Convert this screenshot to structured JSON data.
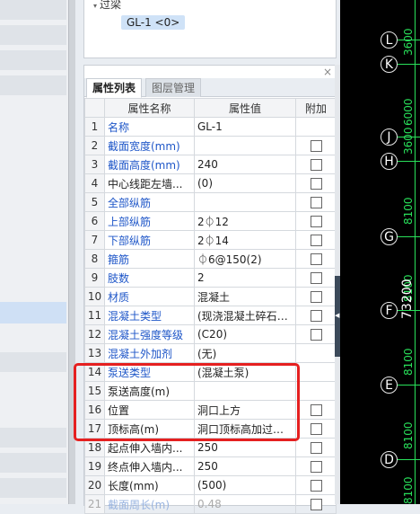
{
  "tree": {
    "node_label": "过梁",
    "leaf_label": "GL-1 <0>"
  },
  "panel": {
    "close_glyph": "×",
    "tabs": [
      "属性列表",
      "图层管理"
    ],
    "columns": [
      "",
      "属性名称",
      "属性值",
      "附加"
    ]
  },
  "rows": [
    {
      "n": "1",
      "name": "名称",
      "value": "GL-1",
      "blue": true,
      "check": false
    },
    {
      "n": "2",
      "name": "截面宽度(mm)",
      "value": "",
      "blue": true,
      "check": true
    },
    {
      "n": "3",
      "name": "截面高度(mm)",
      "value": "240",
      "blue": true,
      "check": true
    },
    {
      "n": "4",
      "name": "中心线距左墙...",
      "value": "(0)",
      "blue": false,
      "check": true
    },
    {
      "n": "5",
      "name": "全部纵筋",
      "value": "",
      "blue": true,
      "check": true
    },
    {
      "n": "6",
      "name": "上部纵筋",
      "value": "2⏀12",
      "blue": true,
      "check": true
    },
    {
      "n": "7",
      "name": "下部纵筋",
      "value": "2⏀14",
      "blue": true,
      "check": true
    },
    {
      "n": "8",
      "name": "箍筋",
      "value": "⏀6@150(2)",
      "blue": true,
      "check": true
    },
    {
      "n": "9",
      "name": "肢数",
      "value": "2",
      "blue": true,
      "check": true
    },
    {
      "n": "10",
      "name": "材质",
      "value": "混凝土",
      "blue": true,
      "check": true
    },
    {
      "n": "11",
      "name": "混凝土类型",
      "value": "(现浇混凝土碎石<...",
      "blue": true,
      "check": true
    },
    {
      "n": "12",
      "name": "混凝土强度等级",
      "value": "(C20)",
      "blue": true,
      "check": true
    },
    {
      "n": "13",
      "name": "混凝土外加剂",
      "value": "(无)",
      "blue": true,
      "check": false
    },
    {
      "n": "14",
      "name": "泵送类型",
      "value": "(混凝土泵)",
      "blue": true,
      "check": false
    },
    {
      "n": "15",
      "name": "泵送高度(m)",
      "value": "",
      "blue": false,
      "check": false
    },
    {
      "n": "16",
      "name": "位置",
      "value": "洞口上方",
      "blue": false,
      "check": true
    },
    {
      "n": "17",
      "name": "顶标高(m)",
      "value": "洞口顶标高加过梁...",
      "blue": false,
      "check": true
    },
    {
      "n": "18",
      "name": "起点伸入墙内...",
      "value": "250",
      "blue": false,
      "check": true
    },
    {
      "n": "19",
      "name": "终点伸入墙内...",
      "value": "250",
      "blue": false,
      "check": true
    },
    {
      "n": "20",
      "name": "长度(mm)",
      "value": "(500)",
      "blue": false,
      "check": true
    },
    {
      "n": "21",
      "name": "截面周长(m)",
      "value": "0.48",
      "blue": false,
      "check": true,
      "faded": true
    }
  ],
  "cad": {
    "axes": [
      {
        "label": "L"
      },
      {
        "label": "K"
      },
      {
        "label": "J"
      },
      {
        "label": "H"
      },
      {
        "label": "G"
      },
      {
        "label": "F"
      },
      {
        "label": "E"
      },
      {
        "label": "D"
      }
    ],
    "dims": [
      "3600",
      "6000",
      "3600",
      "8100",
      "8100",
      "8100",
      "8100",
      "8100"
    ],
    "total_dim": "73200"
  },
  "colors": {
    "link_blue": "#1e56c8",
    "highlight_red": "#e52020",
    "cad_green": "#29e05a"
  }
}
